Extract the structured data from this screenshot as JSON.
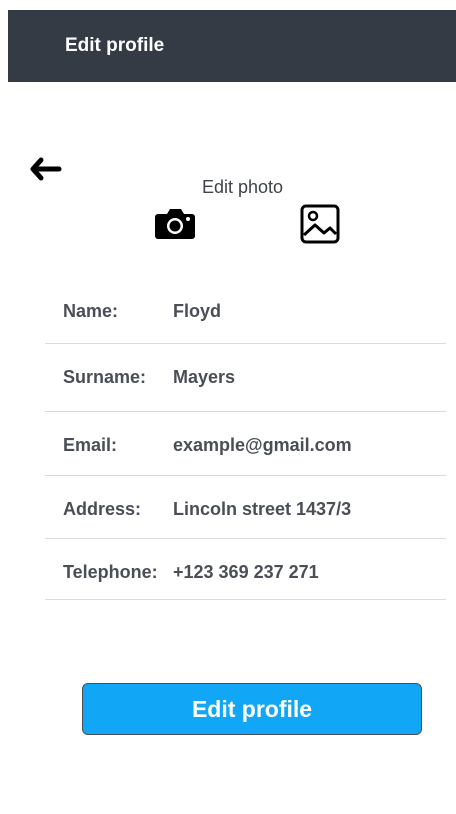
{
  "header": {
    "title": "Edit profile"
  },
  "navigation": {
    "back_icon": "arrow-left-icon"
  },
  "photo": {
    "label": "Edit photo",
    "camera_icon": "camera-icon",
    "gallery_icon": "image-icon"
  },
  "profile": {
    "fields": [
      {
        "label": "Name:",
        "value": "Floyd"
      },
      {
        "label": "Surname:",
        "value": "Mayers"
      },
      {
        "label": "Email:",
        "value": "example@gmail.com"
      },
      {
        "label": "Address:",
        "value": "Lincoln street 1437/3"
      },
      {
        "label": "Telephone:",
        "value": "+123 369 237 271"
      }
    ]
  },
  "actions": {
    "edit_profile_label": "Edit profile"
  },
  "colors": {
    "header_background": "#353b45",
    "primary_button": "#12a7f6",
    "text": "#4a4e56",
    "divider": "#d8dbe0"
  }
}
